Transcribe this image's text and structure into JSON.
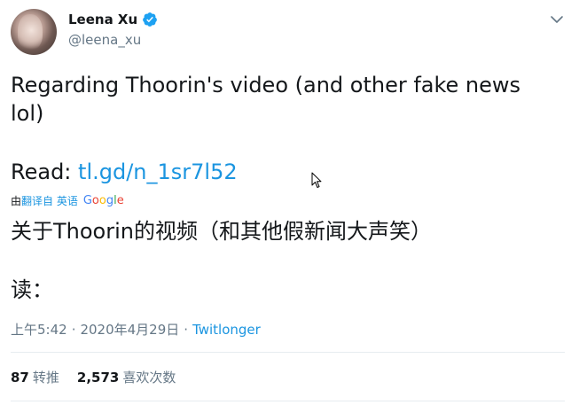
{
  "author": {
    "name": "Leena Xu",
    "handle": "@leena_xu"
  },
  "tweet": {
    "line1": "Regarding Thoorin's video (and other fake news lol)",
    "read_label": "Read: ",
    "read_link": "tl.gd/n_1sr7l52",
    "translate": {
      "by": "由",
      "link": "翻译自 英语",
      "google": [
        "G",
        "o",
        "o",
        "g",
        "l",
        "e"
      ]
    },
    "cn_line1": "关于Thoorin的视频（和其他假新闻大声笑）",
    "cn_line2": "读："
  },
  "meta": {
    "time": "上午5:42",
    "separator": "·",
    "date": "2020年4月29日",
    "source": "Twitlonger"
  },
  "stats": {
    "retweets_count": "87",
    "retweets_label": "转推",
    "likes_count": "2,573",
    "likes_label": "喜欢次数"
  },
  "icons": {
    "verified": "verified-badge-icon",
    "chevron": "chevron-down-icon",
    "cursor": "mouse-pointer-icon"
  },
  "colors": {
    "link": "#1b95e0",
    "secondary_text": "#657786",
    "primary_text": "#14171a"
  }
}
